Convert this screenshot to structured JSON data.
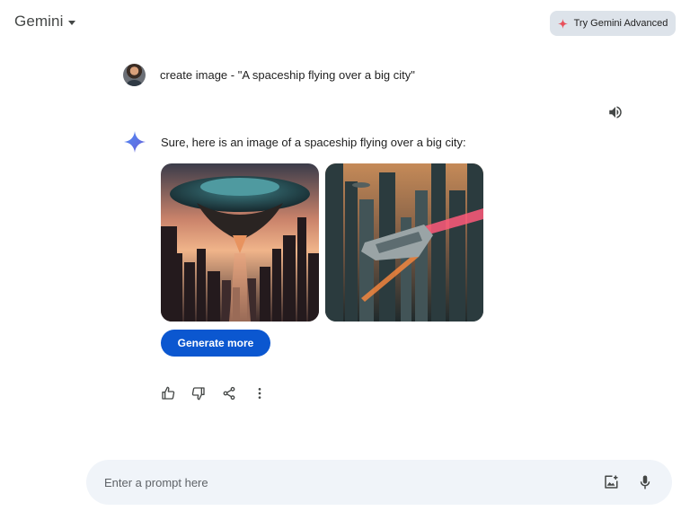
{
  "header": {
    "title": "Gemini",
    "advanced_button": "Try Gemini Advanced"
  },
  "conversation": {
    "user_prompt": "create image - \"A spaceship flying over a big city\"",
    "response_text": "Sure, here is an image of a spaceship flying over a big city:",
    "generate_more_label": "Generate more",
    "images": [
      "spaceship-over-city-image-1",
      "spaceship-over-city-image-2"
    ]
  },
  "actions": [
    "thumbs-up-icon",
    "thumbs-down-icon",
    "share-icon",
    "more-vert-icon"
  ],
  "prompt": {
    "placeholder": "Enter a prompt here"
  },
  "colors": {
    "accent": "#0b57d0",
    "prompt_bg": "#f0f4f9",
    "advanced_bg": "#dde3ea",
    "star_blue": "#4285f4"
  }
}
